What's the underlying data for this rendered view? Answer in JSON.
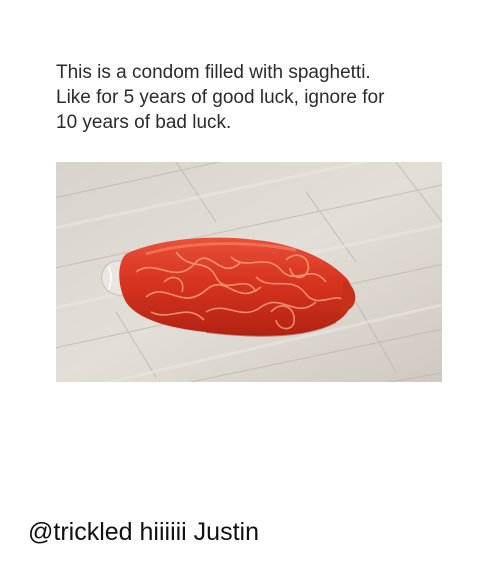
{
  "meme": {
    "caption_lines": [
      "This is a condom filled with spaghetti.",
      "Like for 5 years of good luck, ignore for",
      "10 years of bad luck."
    ]
  },
  "footer": {
    "text": "@trickled hiiiiii Justin"
  }
}
